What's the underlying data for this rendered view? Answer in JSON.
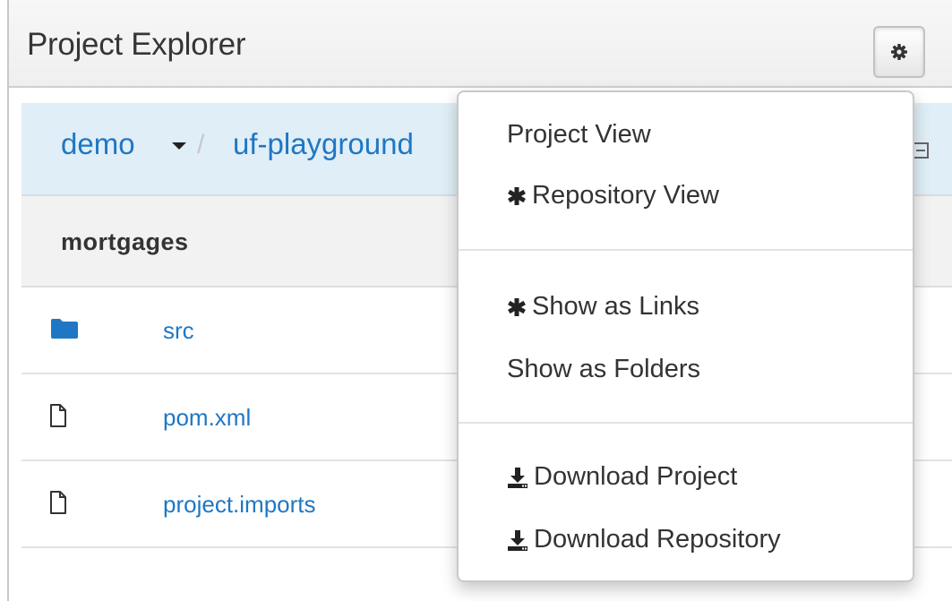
{
  "panel": {
    "title": "Project Explorer"
  },
  "breadcrumb": {
    "org": "demo",
    "separator": "/",
    "repository": "uf-playground"
  },
  "project": {
    "name": "mortgages"
  },
  "files": [
    {
      "name": "src",
      "type": "folder"
    },
    {
      "name": "pom.xml",
      "type": "file"
    },
    {
      "name": "project.imports",
      "type": "file"
    }
  ],
  "menu": {
    "project_view": "Project View",
    "repository_view": "Repository View",
    "show_as_links": "Show as Links",
    "show_as_folders": "Show as Folders",
    "download_project": "Download Project",
    "download_repository": "Download Repository"
  },
  "colors": {
    "link": "#1f77c4",
    "breadcrumb_bg": "#e0eef7"
  },
  "icons": [
    "gear-icon",
    "caret-down-icon",
    "collapse-icon",
    "folder-icon",
    "file-icon",
    "asterisk-icon",
    "download-icon"
  ]
}
